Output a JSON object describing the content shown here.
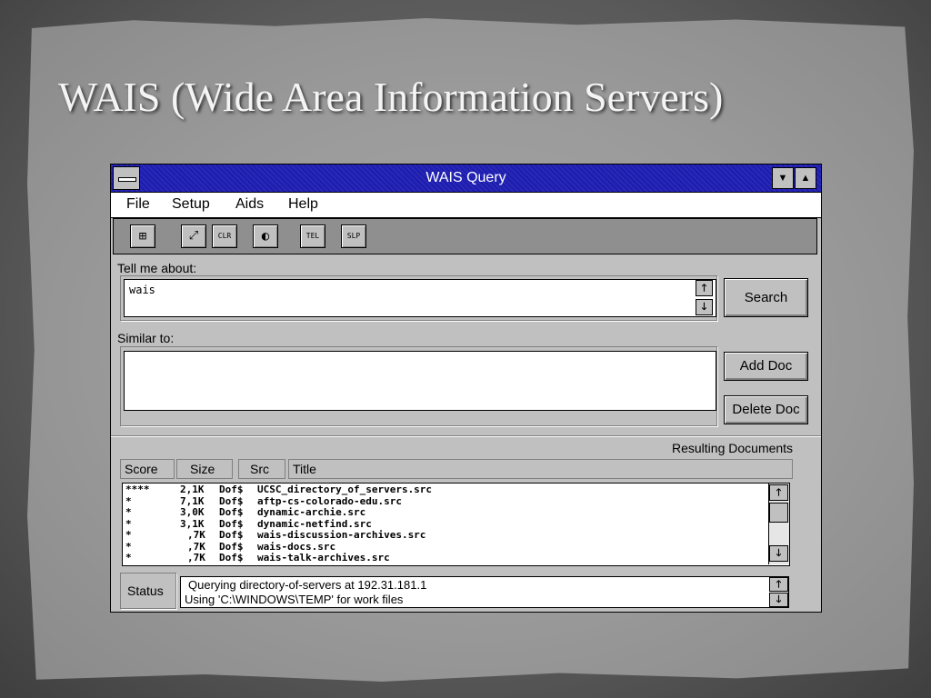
{
  "slide": {
    "title": "WAIS (Wide Area Information Servers)"
  },
  "window": {
    "title": "WAIS Query",
    "minimize_glyph": "▼",
    "maximize_glyph": "▲"
  },
  "menu": {
    "items": [
      "File",
      "Setup",
      "Aids",
      "Help"
    ]
  },
  "toolbar": {
    "tools": [
      {
        "name": "table-tool-icon",
        "glyph": "⊞"
      },
      {
        "name": "resize-tool-icon",
        "glyph": "⤢"
      },
      {
        "name": "clear-tool-icon",
        "glyph": "CLR"
      },
      {
        "name": "globe-tool-icon",
        "glyph": "◐"
      },
      {
        "name": "telnet-tool-icon",
        "glyph": "TEL"
      },
      {
        "name": "slip-tool-icon",
        "glyph": "SLP"
      }
    ]
  },
  "query": {
    "label": "Tell me about:",
    "value": "wais",
    "search_button": "Search"
  },
  "similar": {
    "label": "Similar to:",
    "value": "",
    "add_doc_button": "Add Doc",
    "delete_doc_button": "Delete Doc"
  },
  "results": {
    "heading": "Resulting Documents",
    "columns": [
      "Score",
      "Size",
      "Src",
      "Title"
    ],
    "rows": [
      {
        "score": "****",
        "size": "2,1K",
        "src": "Dof$",
        "title": "UCSC_directory_of_servers.src"
      },
      {
        "score": "*",
        "size": "7,1K",
        "src": "Dof$",
        "title": "aftp-cs-colorado-edu.src"
      },
      {
        "score": "*",
        "size": "3,0K",
        "src": "Dof$",
        "title": "dynamic-archie.src"
      },
      {
        "score": "*",
        "size": "3,1K",
        "src": "Dof$",
        "title": "dynamic-netfind.src"
      },
      {
        "score": "*",
        "size": ",7K",
        "src": "Dof$",
        "title": "wais-discussion-archives.src"
      },
      {
        "score": "*",
        "size": ",7K",
        "src": "Dof$",
        "title": "wais-docs.src"
      },
      {
        "score": "*",
        "size": ",7K",
        "src": "Dof$",
        "title": "wais-talk-archives.src"
      }
    ]
  },
  "status": {
    "label": "Status",
    "lines": [
      "Querying directory-of-servers at 192.31.181.1",
      "Using 'C:\\WINDOWS\\TEMP' for work files"
    ]
  }
}
